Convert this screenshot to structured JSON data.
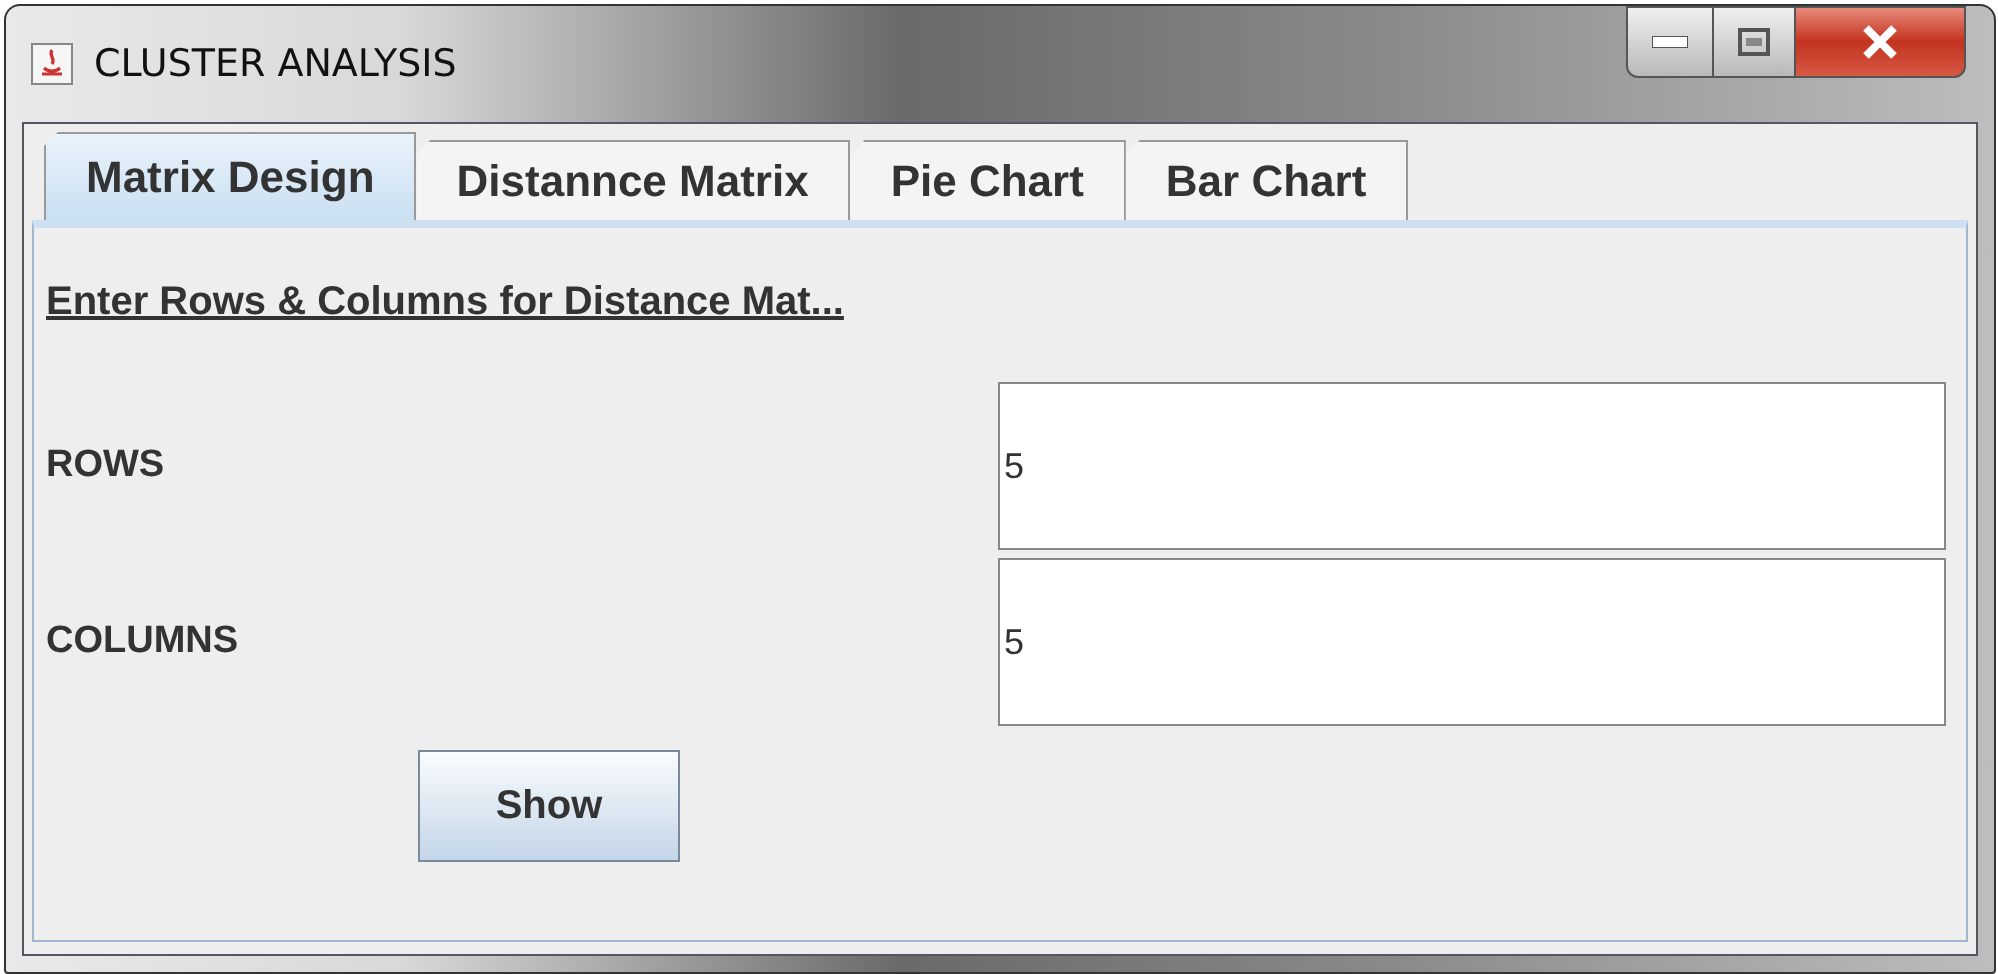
{
  "window": {
    "title": "CLUSTER ANALYSIS"
  },
  "tabs": [
    {
      "label": "Matrix Design",
      "selected": true
    },
    {
      "label": "Distannce Matrix",
      "selected": false
    },
    {
      "label": "Pie Chart",
      "selected": false
    },
    {
      "label": "Bar Chart",
      "selected": false
    }
  ],
  "heading": "Enter Rows & Columns for Distance Mat...",
  "fields": [
    {
      "label": "ROWS",
      "value": "5"
    },
    {
      "label": "COLUMNS",
      "value": "5"
    }
  ],
  "button": "Show"
}
